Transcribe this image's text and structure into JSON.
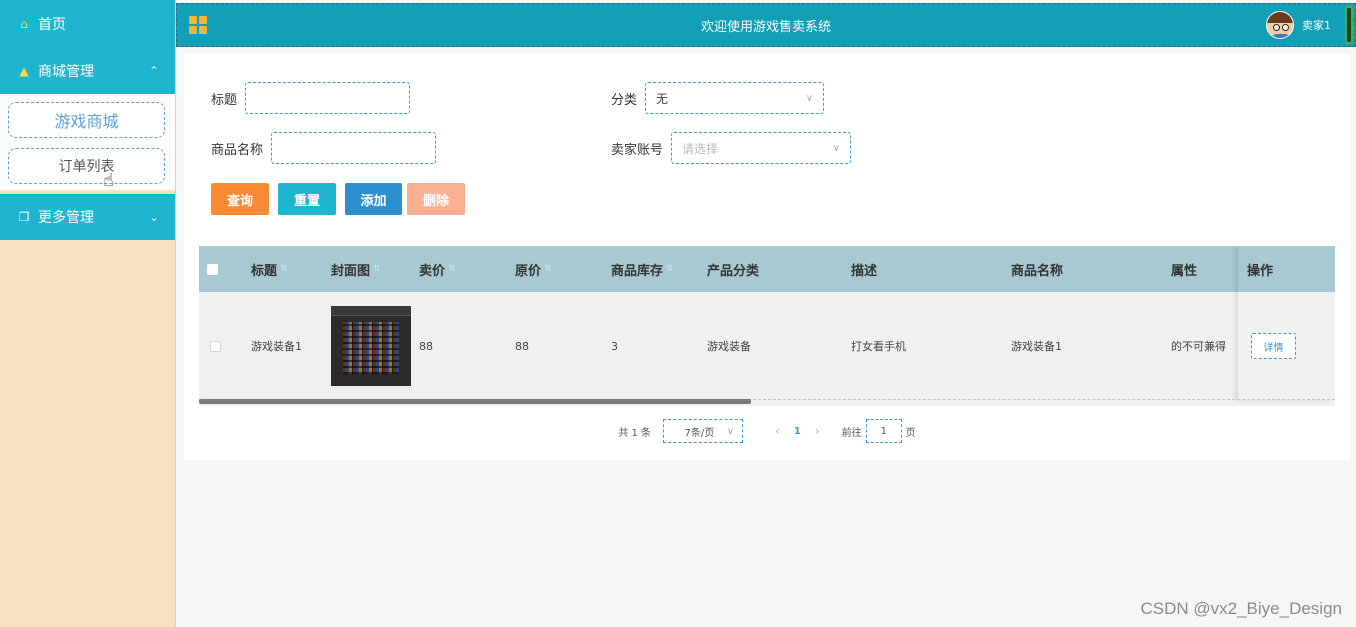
{
  "sidebar": {
    "items": [
      {
        "label": "首页",
        "icon": "home-icon"
      },
      {
        "label": "商城管理",
        "icon": "bag-icon",
        "chevron": "⌃"
      },
      {
        "label": "更多管理",
        "icon": "copy-icon",
        "chevron": "⌄"
      }
    ],
    "sub_items": [
      {
        "label": "游戏商城"
      },
      {
        "label": "订单列表"
      }
    ]
  },
  "header": {
    "title": "欢迎使用游戏售卖系统",
    "user_name": "卖家1"
  },
  "search": {
    "title_label": "标题",
    "title_value": "",
    "category_label": "分类",
    "category_value": "无",
    "product_name_label": "商品名称",
    "product_name_value": "",
    "seller_label": "卖家账号",
    "seller_placeholder": "请选择"
  },
  "actions": {
    "query": "查询",
    "reset": "重置",
    "add": "添加",
    "delete": "删除"
  },
  "table": {
    "columns": [
      "标题",
      "封面图",
      "卖价",
      "原价",
      "商品库存",
      "产品分类",
      "描述",
      "商品名称",
      "属性",
      "操作"
    ],
    "rows": [
      {
        "title": "游戏装备1",
        "price": "88",
        "original_price": "88",
        "stock": "3",
        "category": "游戏装备",
        "description": "打女看手机",
        "product_name": "游戏装备1",
        "attribute": "的不可兼得",
        "action": "详情"
      }
    ]
  },
  "pagination": {
    "total_text": "共 1 条",
    "page_size": "7条/页",
    "prev": "‹",
    "current": "1",
    "next": "›",
    "goto_prefix": "前往",
    "goto_value": "1",
    "goto_suffix": "页"
  },
  "watermark": "CSDN @vx2_Biye_Design",
  "colors": {
    "sidebar_bg": "#f8e1c0",
    "header_bg": "#11a0b8",
    "query": "#f98933",
    "reset": "#1fb5cf",
    "add": "#2b8fd0",
    "delete": "#f9b090"
  }
}
